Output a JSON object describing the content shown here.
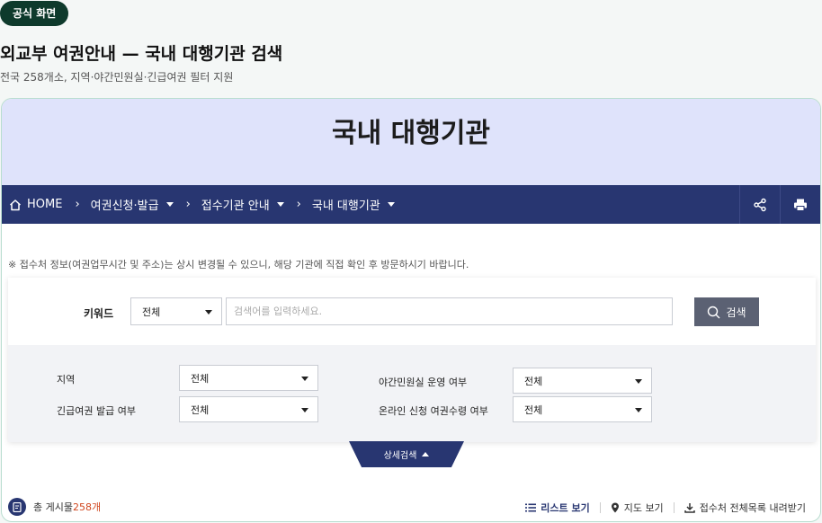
{
  "badge": "공식 화면",
  "page": {
    "title": "외교부 여권안내 — 국내 대행기관 검색",
    "subtitle": "전국 258개소, 지역·야간민원실·긴급여권 필터 지원"
  },
  "hero": {
    "title": "국내 대행기관"
  },
  "breadcrumb": {
    "home": "HOME",
    "items": [
      "여권신청·발급",
      "접수기관 안내",
      "국내 대행기관"
    ]
  },
  "nav_actions": {
    "share_icon": "share-icon",
    "print_icon": "print-icon"
  },
  "notice": "※ 접수처 정보(여권업무시간 및 주소)는 상시 변경될 수 있으니, 해당 기관에 직접 확인 후 방문하시기 바랍니다.",
  "search": {
    "keyword_label": "키워드",
    "scope_value": "전체",
    "placeholder": "검색어를 입력하세요.",
    "button_label": "검색"
  },
  "filters": {
    "region": {
      "label": "지역",
      "value": "전체"
    },
    "night_office": {
      "label": "야간민원실 운영 여부",
      "value": "전체"
    },
    "emergency": {
      "label": "긴급여권 발급 여부",
      "value": "전체"
    },
    "online_pickup": {
      "label": "온라인 신청 여권수령 여부",
      "value": "전체"
    }
  },
  "advanced_toggle": "상세검색",
  "results": {
    "count_prefix": "총 게시물 ",
    "count_value": "258개"
  },
  "views": {
    "list": "리스트 보기",
    "map": "지도 보기",
    "download": "접수처 전체목록 내려받기"
  },
  "colors": {
    "nav": "#283671",
    "hero": "#dfe3fb",
    "badge": "#0e3a2c",
    "count_accent": "#d0461e",
    "search_button": "#5b6173"
  }
}
